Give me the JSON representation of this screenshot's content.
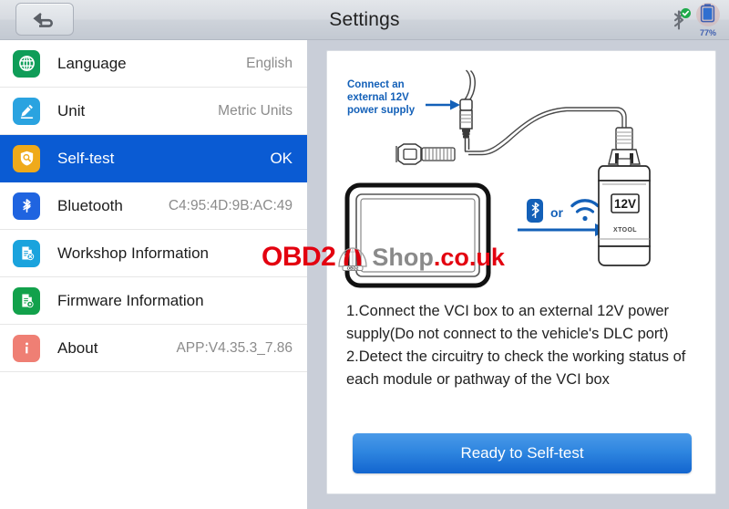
{
  "header": {
    "title": "Settings",
    "back_icon": "back-arrow-icon",
    "bluetooth_icon": "bluetooth-icon",
    "bluetooth_status_icon": "green-check-icon",
    "battery_icon": "battery-icon",
    "battery_percent": "77%"
  },
  "sidebar": {
    "items": [
      {
        "label": "Language",
        "value": "English",
        "icon": "globe-icon",
        "icon_color": "#0f9d58",
        "selected": false
      },
      {
        "label": "Unit",
        "value": "Metric Units",
        "icon": "pencil-edit-icon",
        "icon_color": "#2aa3e0",
        "selected": false
      },
      {
        "label": "Self-test",
        "value": "OK",
        "icon": "shield-search-icon",
        "icon_color": "#efaa1b",
        "selected": true
      },
      {
        "label": "Bluetooth",
        "value": "C4:95:4D:9B:AC:49",
        "icon": "bluetooth-icon",
        "icon_color": "#1f64e0",
        "selected": false
      },
      {
        "label": "Workshop Information",
        "value": "",
        "icon": "document-x-icon",
        "icon_color": "#1aa3dd",
        "selected": false
      },
      {
        "label": "Firmware Information",
        "value": "",
        "icon": "document-gear-icon",
        "icon_color": "#12a14b",
        "selected": false
      },
      {
        "label": "About",
        "value": "APP:V4.35.3_7.86",
        "icon": "info-icon",
        "icon_color": "#ef7f74",
        "selected": false
      }
    ],
    "selected_bg": "#0a5bd3"
  },
  "main": {
    "diagram": {
      "callout_lines": [
        "Connect an",
        "external 12V",
        "power supply"
      ],
      "callout_color": "#1360b8",
      "connection_or_label": "or",
      "bluetooth_icon": "bluetooth-icon",
      "wifi_icon": "wifi-icon",
      "arrow_icon": "right-arrow-icon",
      "vci_box_label": "12V",
      "vci_brand": "XTOOL",
      "tablet_icon": "tablet-device-icon",
      "obd_connector_icon": "obd-connector-icon",
      "accent_color": "#1360b8"
    },
    "instructions": [
      "1.Connect the VCI box to an external 12V power supply(Do not connect to the vehicle's DLC port)",
      "2.Detect the circuitry to check the working status of each module or pathway of the VCI box"
    ],
    "action_button": {
      "label": "Ready to Self-test",
      "color": "#1f7ae0"
    }
  },
  "watermark": {
    "part1": "OBD2",
    "part2": "Shop",
    "part3": ".co.uk",
    "car_badge": "OBD2",
    "color1": "#e3000f",
    "color2": "#8a8a8a"
  }
}
